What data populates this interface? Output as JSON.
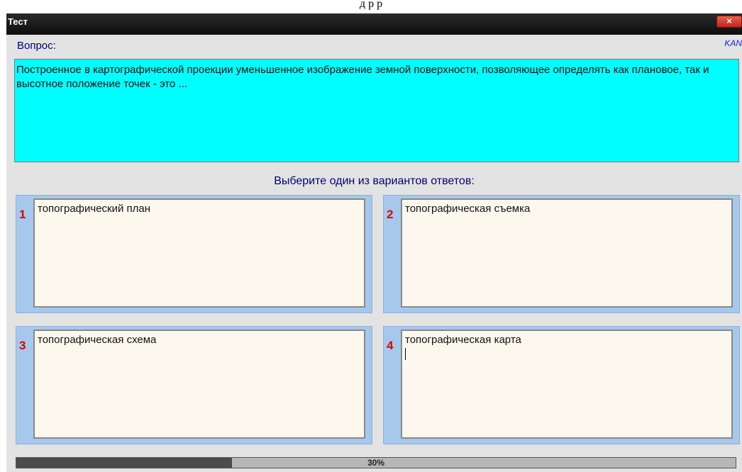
{
  "top_text": "д   р   р",
  "window": {
    "title": "Тест",
    "close_label": "×"
  },
  "question": {
    "label": "Вопрос:",
    "tag": "KAN",
    "text": "Построенное в картографической проекции уменьшенное изображение земной поверхности, позволяющее определять как плановое, так и высотное положение точек - это ..."
  },
  "answers": {
    "prompt": "Выберите один из вариантов ответов:",
    "items": [
      {
        "num": "1",
        "text": "топографический план"
      },
      {
        "num": "2",
        "text": "топографическая съемка"
      },
      {
        "num": "3",
        "text": "топографическая схема"
      },
      {
        "num": "4",
        "text": "топографическая карта"
      }
    ]
  },
  "progress": {
    "value": 0.3,
    "label": "30%"
  }
}
